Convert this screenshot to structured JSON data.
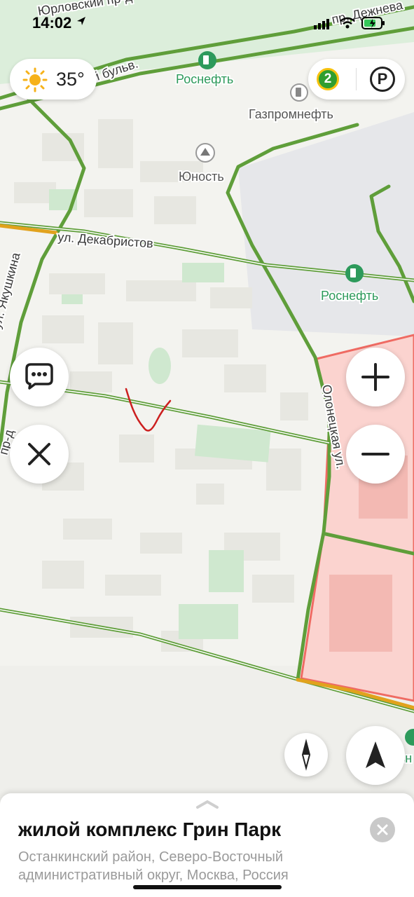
{
  "status_bar": {
    "time": "14:02"
  },
  "weather": {
    "temperature": "35°",
    "icon": "sun-icon"
  },
  "traffic": {
    "level": "2"
  },
  "parking": {
    "label": "P"
  },
  "map": {
    "streets": {
      "yurlovsky": "Юрловский пр-д",
      "dezhneva": "пр. Дежнева",
      "severny": "Северный бульв.",
      "dekabristov": "ул. Декабристов",
      "yakushkina": "ул. Якушкина",
      "olonetskaya": "Олонецкая ул.",
      "left_edge": "пр-д"
    },
    "pois": {
      "rosneft_top": "Роснефть",
      "gazpromneft": "Газпромнефть",
      "yunost": "Юность",
      "rosneft_right": "Роснефть",
      "rosneft_bottom": "Росн"
    }
  },
  "controls": {
    "chat": "chat-icon",
    "close": "close-icon",
    "zoom_in": "plus-icon",
    "zoom_out": "minus-icon",
    "compass": "compass-icon",
    "locate": "navigation-arrow-icon"
  },
  "place": {
    "title": "жилой комплекс Грин Парк",
    "subtitle": "Останкинский район, Северо-Восточный административный округ, Москва, Россия"
  },
  "colors": {
    "road_green": "#5f9e3a",
    "road_orange": "#e1a21d",
    "zone_fill": "#fbd3cf",
    "zone_stroke": "#ef6b63",
    "poi_green": "#2d9a5b",
    "park": "#cfe8cf",
    "annotation": "#cc1f1f"
  }
}
